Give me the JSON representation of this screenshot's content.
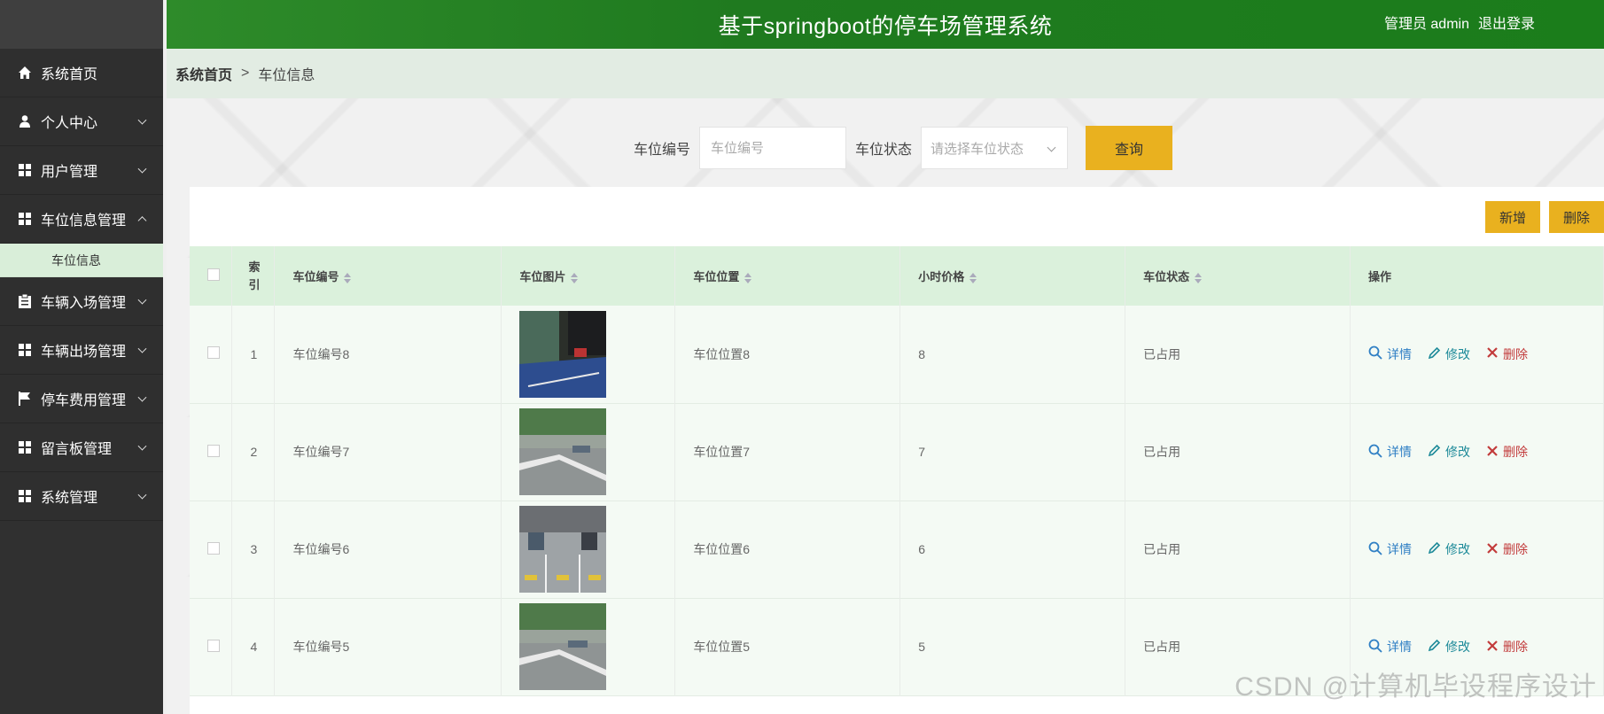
{
  "app": {
    "title": "基于springboot的停车场管理系统",
    "user_label": "管理员 admin",
    "logout_label": "退出登录"
  },
  "sidebar": {
    "items": [
      {
        "label": "系统首页",
        "icon": "home-icon"
      },
      {
        "label": "个人中心",
        "icon": "user-icon"
      },
      {
        "label": "用户管理",
        "icon": "grid-icon"
      },
      {
        "label": "车位信息管理",
        "icon": "grid-icon"
      },
      {
        "label": "车辆入场管理",
        "icon": "clipboard-icon"
      },
      {
        "label": "车辆出场管理",
        "icon": "grid-icon"
      },
      {
        "label": "停车费用管理",
        "icon": "flag-icon"
      },
      {
        "label": "留言板管理",
        "icon": "grid-icon"
      },
      {
        "label": "系统管理",
        "icon": "grid-icon"
      }
    ],
    "submenu": {
      "label": "车位信息"
    }
  },
  "breadcrumb": {
    "home": "系统首页",
    "separator": ">",
    "current": "车位信息"
  },
  "search": {
    "code_label": "车位编号",
    "code_placeholder": "车位编号",
    "status_label": "车位状态",
    "status_placeholder": "请选择车位状态",
    "query_label": "查询"
  },
  "toolbar": {
    "add_label": "新增",
    "delete_label": "删除"
  },
  "table": {
    "headers": {
      "index": "索引",
      "code": "车位编号",
      "image": "车位图片",
      "location": "车位位置",
      "price": "小时价格",
      "status": "车位状态",
      "ops": "操作"
    },
    "rows": [
      {
        "index": "1",
        "code": "车位编号8",
        "location": "车位位置8",
        "price": "8",
        "status": "已占用"
      },
      {
        "index": "2",
        "code": "车位编号7",
        "location": "车位位置7",
        "price": "7",
        "status": "已占用"
      },
      {
        "index": "3",
        "code": "车位编号6",
        "location": "车位位置6",
        "price": "6",
        "status": "已占用"
      },
      {
        "index": "4",
        "code": "车位编号5",
        "location": "车位位置5",
        "price": "5",
        "status": "已占用"
      }
    ],
    "action_labels": {
      "detail": "详情",
      "edit": "修改",
      "delete": "删除"
    }
  },
  "watermark": "CSDN @计算机毕设程序设计",
  "colors": {
    "header": "#1f7a1f",
    "sidebar": "#303030",
    "accent": "#e9b11f",
    "table_header": "#dbf1dc"
  }
}
